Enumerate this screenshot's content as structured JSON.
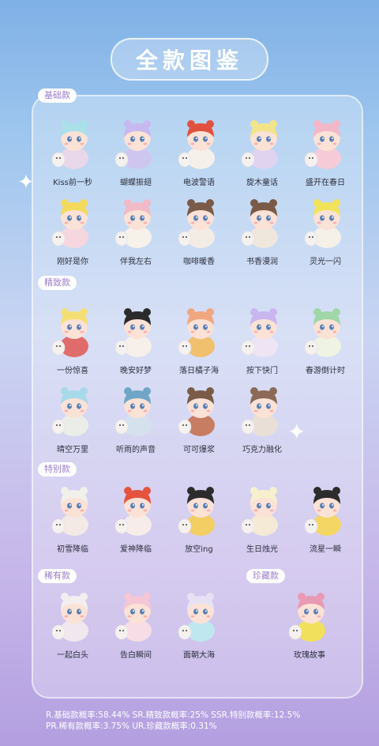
{
  "title": "全款图鉴",
  "sections": {
    "basic": "基础款",
    "fine": "精致款",
    "special": "特别款",
    "rare": "稀有款",
    "treasure": "珍藏款"
  },
  "figures": [
    {
      "name": "Kiss前一秒",
      "hair": "#a9e0ea",
      "body": "#e9d7ea"
    },
    {
      "name": "蝴蝶振翅",
      "hair": "#c8b8f0",
      "body": "#cfc6f0"
    },
    {
      "name": "电波警语",
      "hair": "#e0523f",
      "body": "#f6f0ea"
    },
    {
      "name": "旋木童话",
      "hair": "#f3e48a",
      "body": "#dfd3f0"
    },
    {
      "name": "盛开在春日",
      "hair": "#f4b7c8",
      "body": "#f6cbd7"
    },
    {
      "name": "刚好是你",
      "hair": "#f4da5c",
      "body": "#f6d7df"
    },
    {
      "name": "伴我左右",
      "hair": "#f2b9c6",
      "body": "#f6f2ea"
    },
    {
      "name": "咖啡暖香",
      "hair": "#7a5a49",
      "body": "#f2ece4"
    },
    {
      "name": "书香漫润",
      "hair": "#7b5a48",
      "body": "#efe6dc"
    },
    {
      "name": "灵光一闪",
      "hair": "#f2e35a",
      "body": "#f6f1e8"
    },
    {
      "name": "一份惊喜",
      "hair": "#f3df74",
      "body": "#e06b6b"
    },
    {
      "name": "晚安好梦",
      "hair": "#2b2b2b",
      "body": "#f7efe9"
    },
    {
      "name": "落日橘子海",
      "hair": "#f0a77f",
      "body": "#f0c06e"
    },
    {
      "name": "按下快门",
      "hair": "#c9b6ef",
      "body": "#eee4f4"
    },
    {
      "name": "春游倒计时",
      "hair": "#9fd7a8",
      "body": "#eef3e4"
    },
    {
      "name": "晴空万里",
      "hair": "#a8d9ea",
      "body": "#ebeee8"
    },
    {
      "name": "听雨的声音",
      "hair": "#6fa6c7",
      "body": "#d5e2ee"
    },
    {
      "name": "可可爆浆",
      "hair": "#7a5b48",
      "body": "#c77d62"
    },
    {
      "name": "巧克力融化",
      "hair": "#8c6a57",
      "body": "#e9dfd6"
    },
    {
      "name": "初雪降临",
      "hair": "#f1f0ea",
      "body": "#f3e9e5"
    },
    {
      "name": "爱神降临",
      "hair": "#e5533f",
      "body": "#f6ecea"
    },
    {
      "name": "放空ing",
      "hair": "#2c2c2c",
      "body": "#f3ce62"
    },
    {
      "name": "生日烛光",
      "hair": "#f6f0cf",
      "body": "#f5ead6"
    },
    {
      "name": "流星一瞬",
      "hair": "#2c2c2c",
      "body": "#f4d665"
    },
    {
      "name": "一起白头",
      "hair": "#f3eff0",
      "body": "#f1e7ee"
    },
    {
      "name": "告白瞬间",
      "hair": "#f5c6d6",
      "body": "#f7dde6"
    },
    {
      "name": "面朝大海",
      "hair": "#e7e2f3",
      "body": "#bfe7ef"
    },
    {
      "name": "玫瑰故事",
      "hair": "#e89ab4",
      "body": "#f1e05c"
    }
  ],
  "odds": [
    "R.基础款概率:58.44% SR.精致款概率:25% SSR.特别款概率:12.5%",
    "PR.稀有款概率:3.75% UR.珍藏款概率:0.31%"
  ]
}
